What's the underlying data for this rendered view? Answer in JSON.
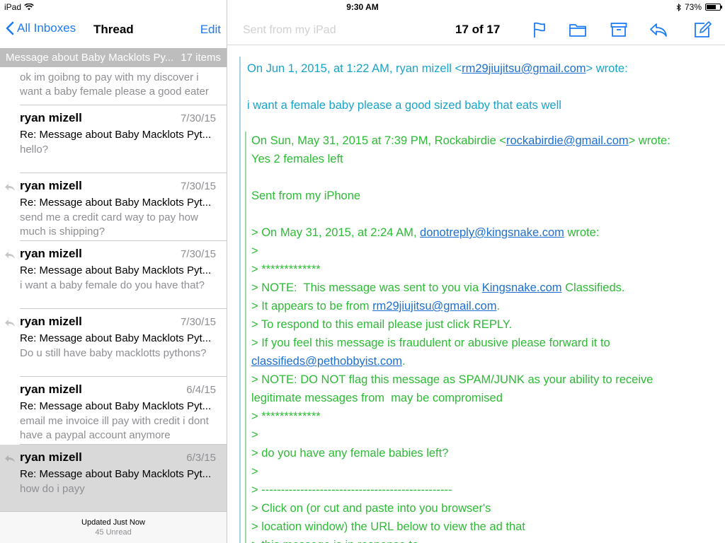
{
  "status": {
    "device": "iPad",
    "time": "9:30 AM",
    "battery": "73%",
    "battery_level": 0.73
  },
  "left": {
    "back_label": "All Inboxes",
    "title": "Thread",
    "edit_label": "Edit",
    "thread_subject": "Message about Baby Macklots Py...",
    "thread_count": "17 items",
    "partial_preview": "ok im goibng to pay with my discover i want a baby female please a good eater",
    "messages": [
      {
        "sender": "ryan mizell",
        "date": "7/30/15",
        "subject": "Re: Message about Baby Macklots Pyt...",
        "preview": "hello?"
      },
      {
        "sender": "ryan mizell",
        "date": "7/30/15",
        "subject": "Re: Message about Baby Macklots Pyt...",
        "preview": "send me a credit card way to pay how much is shipping?"
      },
      {
        "sender": "ryan mizell",
        "date": "7/30/15",
        "subject": "Re: Message about Baby Macklots Pyt...",
        "preview": "i want a baby female do you have that?"
      },
      {
        "sender": "ryan mizell",
        "date": "7/30/15",
        "subject": "Re: Message about Baby Macklots Pyt...",
        "preview": "Do u still have baby macklotts pythons?"
      },
      {
        "sender": "ryan mizell",
        "date": "6/4/15",
        "subject": "Re: Message about Baby Macklots Pyt...",
        "preview": "email me invoice ill pay with credit i dont have a paypal account anymore"
      },
      {
        "sender": "ryan mizell",
        "date": "6/3/15",
        "subject": "Re: Message about Baby Macklots Pyt...",
        "preview": "how do i payy"
      }
    ],
    "footer_updated": "Updated Just Now",
    "footer_unread": "45 Unread"
  },
  "right": {
    "ghost_text": "Sent from my iPad",
    "counter": "17 of 17",
    "icons": [
      "flag-icon",
      "folder-icon",
      "archive-icon",
      "reply-icon",
      "compose-icon"
    ],
    "quote1": {
      "header_prefix": "On Jun 1, 2015, at 1:22 AM, ryan mizell <",
      "header_link": "rm29jiujitsu@gmail.com",
      "header_suffix": "> wrote:",
      "body": "i want a female baby please a good sized baby that eats well"
    },
    "quote2": {
      "header_prefix": "On Sun, May 31, 2015 at 7:39 PM, Rockabirdie <",
      "header_link": "rockabirdie@gmail.com",
      "header_suffix": "> wrote:",
      "l1": "Yes 2 females left",
      "l2": "Sent from my iPhone",
      "l3_prefix": "> On May 31, 2015, at 2:24 AM, ",
      "l3_link": "donotreply@kingsnake.com",
      "l3_suffix": " wrote:",
      "l4": ">",
      "l5": "> *************",
      "l6_prefix": "> NOTE:  This message was sent to you via ",
      "l6_link": "Kingsnake.com",
      "l6_suffix": " Classifieds.",
      "l7_prefix": "> It appears to be from ",
      "l7_link": "rm29jiujitsu@gmail.com",
      "l7_suffix": ".",
      "l8": "> To respond to this email please just click REPLY.",
      "l9": "> If you feel this message is fraudulent or abusive please forward it to",
      "l10_link": "classifieds@pethobbyist.com",
      "l10_suffix": ".",
      "l11": "> NOTE: DO NOT flag this message as SPAM/JUNK as your ability to receive legitimate messages from  may be compromised",
      "l12": "> *************",
      "l13": ">",
      "l14": "> do you have any female babies left?",
      "l15": ">",
      "l16": "> -------------------------------------------------",
      "l17": "> Click on (or cut and paste into you browser's",
      "l18": "> location window) the URL below to view the ad that",
      "l19": "> this message is in response to"
    }
  },
  "colors": {
    "accent": "#1d7bf2",
    "quote1": "#1aa3c9",
    "quote2": "#2dba35",
    "link": "#1d6fd1"
  }
}
